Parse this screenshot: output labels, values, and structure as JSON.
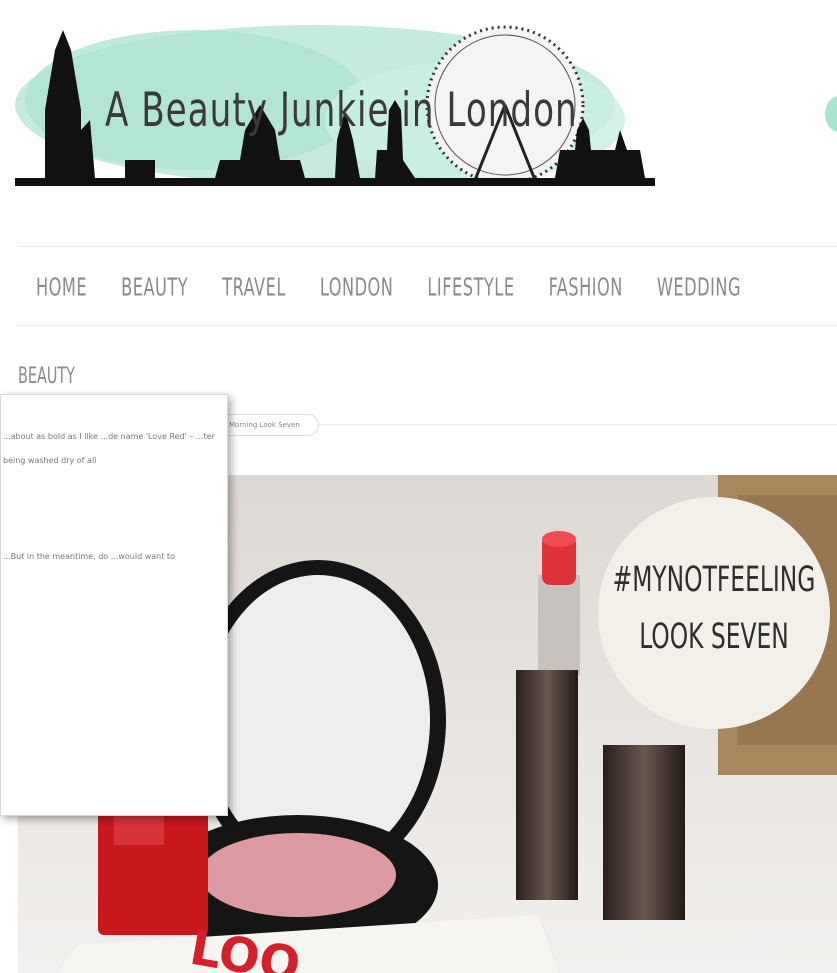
{
  "site": {
    "title": "A Beauty Junkie in London",
    "accent_color": "#a8e3cf"
  },
  "nav": {
    "items": [
      "HOME",
      "BEAUTY",
      "TRAVEL",
      "LONDON",
      "LIFESTYLE",
      "FASHION",
      "WEDDING"
    ]
  },
  "category": "BEAUTY",
  "breadcrumb": "Morning Look Seven",
  "popup": {
    "paragraph1": "...about as bold as I like ...de name 'Love Red' – ...ter being washed dry of all",
    "paragraph2": "...But in the meantime, do ...would want to"
  },
  "hero": {
    "badge_line1": "#MYNOTFEELING",
    "badge_line2": "LOOK SEVEN",
    "card_text": "LOO"
  }
}
